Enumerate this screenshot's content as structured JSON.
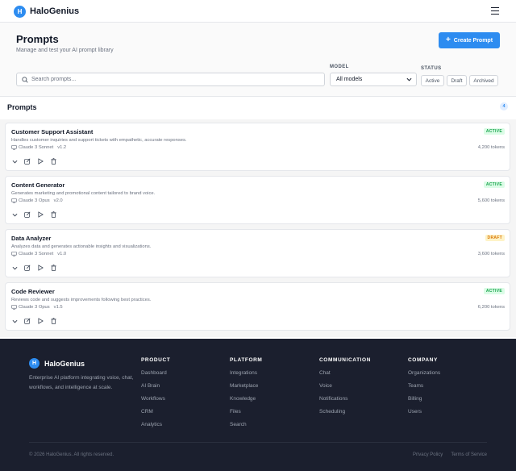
{
  "app": {
    "logo_letter": "H",
    "name": "HaloGenius"
  },
  "header": {
    "title": "Prompts",
    "subtitle": "Manage and test your AI prompt library",
    "create_label": "Create Prompt",
    "search_placeholder": "Search prompts...",
    "model_label": "MODEL",
    "model_value": "All models",
    "status_label": "STATUS",
    "status_options": [
      "Active",
      "Draft",
      "Archived"
    ]
  },
  "section": {
    "title": "Prompts",
    "count": "4"
  },
  "prompts": [
    {
      "title": "Customer Support Assistant",
      "description": "Handles customer inquiries and support tickets with empathetic, accurate responses.",
      "model": "Claude 3 Sonnet",
      "version": "v1.2",
      "status": "ACTIVE",
      "tokens": "4,200 tokens"
    },
    {
      "title": "Content Generator",
      "description": "Generates marketing and promotional content tailored to brand voice.",
      "model": "Claude 3 Opus",
      "version": "v2.0",
      "status": "ACTIVE",
      "tokens": "5,600 tokens"
    },
    {
      "title": "Data Analyzer",
      "description": "Analyzes data and generates actionable insights and visualizations.",
      "model": "Claude 3 Sonnet",
      "version": "v1.0",
      "status": "DRAFT",
      "tokens": "3,600 tokens"
    },
    {
      "title": "Code Reviewer",
      "description": "Reviews code and suggests improvements following best practices.",
      "model": "Claude 3 Opus",
      "version": "v1.5",
      "status": "ACTIVE",
      "tokens": "6,200 tokens"
    }
  ],
  "colors": {
    "accent": "#2d8cf0",
    "active": "#16a34a",
    "draft": "#d97706",
    "footer_bg": "#1b1f2e"
  },
  "footer": {
    "logo_letter": "H",
    "name": "HaloGenius",
    "tagline": "Enterprise AI platform integrating voice, chat, workflows, and intelligence at scale.",
    "columns": [
      {
        "heading": "PRODUCT",
        "links": [
          "Dashboard",
          "AI Brain",
          "Workflows",
          "CRM",
          "Analytics"
        ]
      },
      {
        "heading": "PLATFORM",
        "links": [
          "Integrations",
          "Marketplace",
          "Knowledge",
          "Files",
          "Search"
        ]
      },
      {
        "heading": "COMMUNICATION",
        "links": [
          "Chat",
          "Voice",
          "Notifications",
          "Scheduling"
        ]
      },
      {
        "heading": "COMPANY",
        "links": [
          "Organizations",
          "Teams",
          "Billing",
          "Users"
        ]
      }
    ],
    "copyright": "© 2026 HaloGenius. All rights reserved.",
    "legal": [
      "Privacy Policy",
      "Terms of Service"
    ]
  }
}
